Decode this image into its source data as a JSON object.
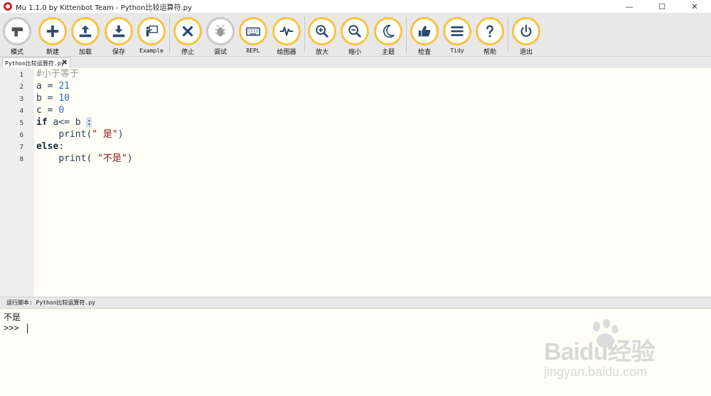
{
  "window": {
    "title": "Mu 1.1.0 by Kittenbot Team - Python比较运算符.py",
    "controls": [
      "—",
      "☐",
      "✕"
    ]
  },
  "toolbar": {
    "mode": "模式",
    "new": "新建",
    "load": "加载",
    "save": "保存",
    "example": "Example",
    "stop": "停止",
    "debug": "调试",
    "repl": "REPL",
    "plotter": "绘图器",
    "zoom_in": "放大",
    "zoom_out": "缩小",
    "theme": "主题",
    "check": "检查",
    "tidy": "Tidy",
    "help": "帮助",
    "quit": "退出"
  },
  "tabs": [
    {
      "label": "Python比较运算符.py",
      "close": "✖"
    }
  ],
  "editor": {
    "line_numbers": [
      "1",
      "2",
      "3",
      "4",
      "5",
      "6",
      "7",
      "8"
    ],
    "lines": {
      "l1": "#小于等于",
      "l2_var": "a",
      "l2_eq": " = ",
      "l2_val": "21",
      "l3_var": "b",
      "l3_eq": " = ",
      "l3_val": "10",
      "l4_var": "c",
      "l4_eq": " = ",
      "l4_val": "0",
      "l5_kw": "if",
      "l5_cond": " a<= b ",
      "l5_colon": ":",
      "l6_indent": "    ",
      "l6_func": "print(",
      "l6_str": "\" 是\"",
      "l6_close": ")",
      "l7_kw": "else",
      "l7_colon": ":",
      "l8_indent": "    ",
      "l8_func": "print( ",
      "l8_str": "\"不是\"",
      "l8_close": ")"
    }
  },
  "run_pane": {
    "header": "运行脚本: Python比较运算符.py",
    "output_line": "不是",
    "prompt": ">>> "
  },
  "watermark": {
    "brand": "Baidu经验",
    "url": "jingyan.baidu.com"
  },
  "colors": {
    "accent": "#f8c340",
    "toolbar_bg": "#e8e8e8",
    "editor_bg": "#fefef7",
    "keyword": "#1a2a3a",
    "number": "#2d6fb5",
    "string": "#8b1a1a",
    "comment": "#9a9a9a"
  }
}
